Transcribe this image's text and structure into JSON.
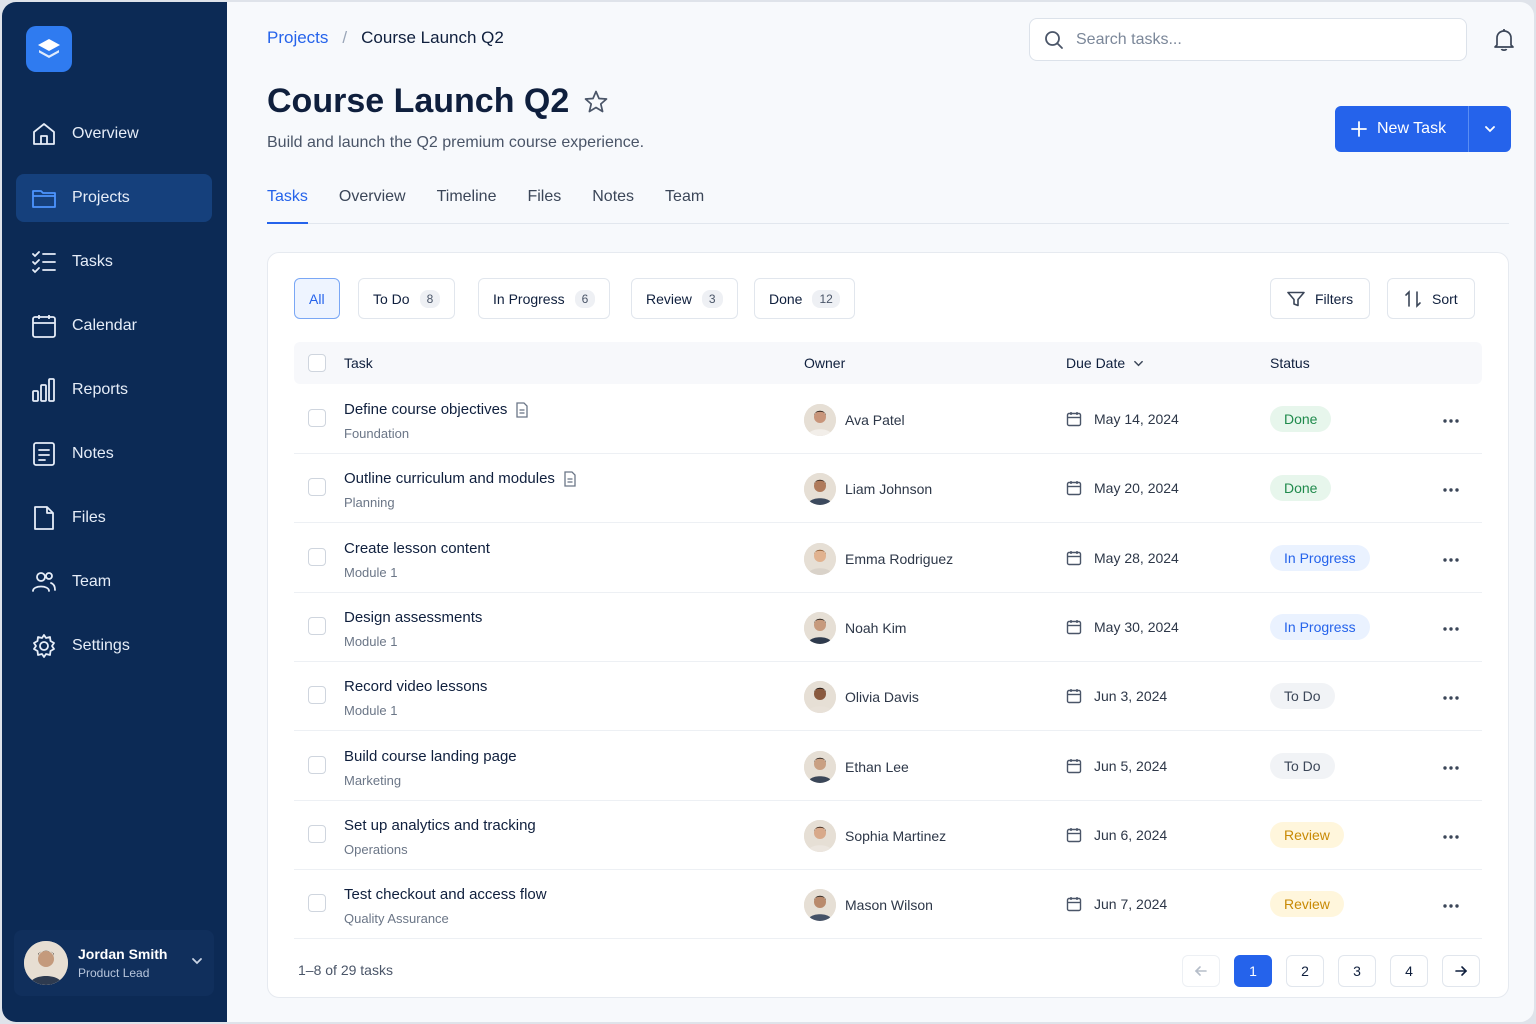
{
  "sidebar": {
    "items": [
      {
        "label": "Overview",
        "icon": "home-icon"
      },
      {
        "label": "Projects",
        "icon": "folder-icon",
        "active": true
      },
      {
        "label": "Tasks",
        "icon": "checklist-icon"
      },
      {
        "label": "Calendar",
        "icon": "calendar-icon"
      },
      {
        "label": "Reports",
        "icon": "bar-chart-icon"
      },
      {
        "label": "Notes",
        "icon": "notes-icon"
      },
      {
        "label": "Files",
        "icon": "file-icon"
      },
      {
        "label": "Team",
        "icon": "team-icon"
      },
      {
        "label": "Settings",
        "icon": "gear-icon"
      }
    ],
    "user": {
      "name": "Jordan Smith",
      "role": "Product Lead"
    }
  },
  "breadcrumb": {
    "parent": "Projects",
    "separator": "/",
    "current": "Course Launch Q2"
  },
  "search": {
    "placeholder": "Search tasks..."
  },
  "header": {
    "title": "Course Launch Q2",
    "subtitle": "Build and launch the Q2 premium course experience.",
    "new_task_label": "New Task"
  },
  "tabs": [
    "Tasks",
    "Overview",
    "Timeline",
    "Files",
    "Notes",
    "Team"
  ],
  "filters": {
    "chips": [
      {
        "label": "All",
        "count": null
      },
      {
        "label": "To Do",
        "count": "8"
      },
      {
        "label": "In Progress",
        "count": "6"
      },
      {
        "label": "Review",
        "count": "3"
      },
      {
        "label": "Done",
        "count": "12"
      }
    ],
    "filters_label": "Filters",
    "sort_label": "Sort"
  },
  "table": {
    "headers": {
      "task": "Task",
      "owner": "Owner",
      "due": "Due Date",
      "status": "Status"
    },
    "rows": [
      {
        "task": "Define course objectives",
        "category": "Foundation",
        "doc": true,
        "owner": "Ava Patel",
        "due": "May 14, 2024",
        "status": "Done"
      },
      {
        "task": "Outline curriculum and modules",
        "category": "Planning",
        "doc": true,
        "owner": "Liam Johnson",
        "due": "May 20, 2024",
        "status": "Done"
      },
      {
        "task": "Create lesson content",
        "category": "Module 1",
        "doc": false,
        "owner": "Emma Rodriguez",
        "due": "May 28, 2024",
        "status": "In Progress"
      },
      {
        "task": "Design assessments",
        "category": "Module 1",
        "doc": false,
        "owner": "Noah Kim",
        "due": "May 30, 2024",
        "status": "In Progress"
      },
      {
        "task": "Record video lessons",
        "category": "Module 1",
        "doc": false,
        "owner": "Olivia Davis",
        "due": "Jun 3, 2024",
        "status": "To Do"
      },
      {
        "task": "Build course landing page",
        "category": "Marketing",
        "doc": false,
        "owner": "Ethan Lee",
        "due": "Jun 5, 2024",
        "status": "To Do"
      },
      {
        "task": "Set up analytics and tracking",
        "category": "Operations",
        "doc": false,
        "owner": "Sophia Martinez",
        "due": "Jun 6, 2024",
        "status": "Review"
      },
      {
        "task": "Test checkout and access flow",
        "category": "Quality Assurance",
        "doc": false,
        "owner": "Mason Wilson",
        "due": "Jun 7, 2024",
        "status": "Review"
      }
    ]
  },
  "status_colors": {
    "Done": {
      "bg": "#e7f6ec",
      "fg": "#1f8a4c"
    },
    "In Progress": {
      "bg": "#eaf2ff",
      "fg": "#2563eb"
    },
    "To Do": {
      "bg": "#f1f3f6",
      "fg": "#3b4658"
    },
    "Review": {
      "bg": "#fff6dc",
      "fg": "#c88a05"
    }
  },
  "pagination": {
    "summary": "1–8 of 29 tasks",
    "pages": [
      "1",
      "2",
      "3",
      "4"
    ],
    "current": "1"
  },
  "colors": {
    "accent": "#2563eb",
    "sidebar": "#0c2a55"
  }
}
